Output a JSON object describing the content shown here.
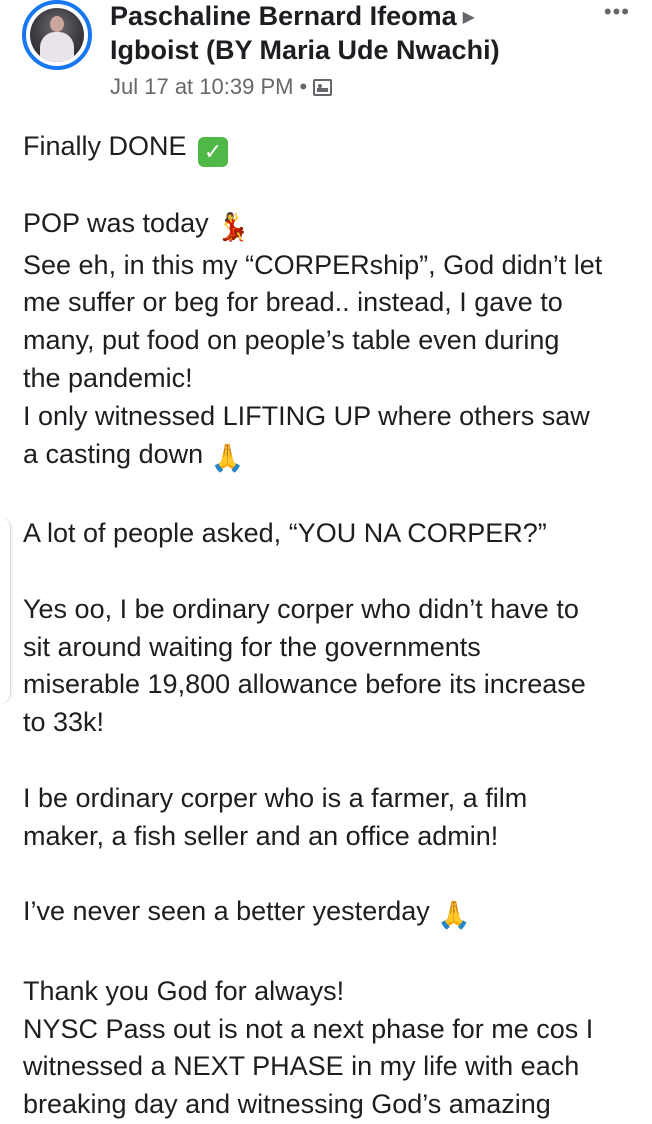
{
  "post": {
    "author": "Paschaline Bernard Ifeoma",
    "shared_to_arrow": "▶",
    "group": "Igboist (BY Maria Ude Nwachi)",
    "timestamp": "Jul 17 at 10:39 PM",
    "separator": "•",
    "audience_icon": "audience-image-icon",
    "more_icon": "•••",
    "colors": {
      "accent": "#1877f2",
      "text": "#1c1e21",
      "meta": "#65676b",
      "check_emoji": "#4fb847"
    }
  },
  "body": {
    "line_1": "Finally DONE",
    "line_1_emoji": "✓",
    "p2_line_1": "POP was today",
    "p2_line_1_emoji": "💃",
    "p2_rest": "See eh, in this my “CORPERship”, God didn’t let\nme suffer or beg for bread.. instead, I gave to\nmany, put food on people’s table even during\nthe pandemic!\nI only witnessed LIFTING UP where others saw",
    "p2_last": "a casting down",
    "p2_last_emoji": "🙏",
    "p3": "A lot of people asked, “YOU NA CORPER?”",
    "p4": "Yes oo, I be ordinary corper who didn’t have to\nsit around waiting for the governments\nmiserable 19,800 allowance before its increase\nto 33k!",
    "p5": "I be ordinary corper who is a farmer, a film\nmaker, a fish seller and an office admin!",
    "p6": "I’ve never seen a better yesterday",
    "p6_emoji": "🙏",
    "p7": "Thank you God for always!\nNYSC Pass out is not a next phase for me cos I\nwitnessed a NEXT PHASE in my life with each\nbreaking day and witnessing God’s amazing"
  }
}
